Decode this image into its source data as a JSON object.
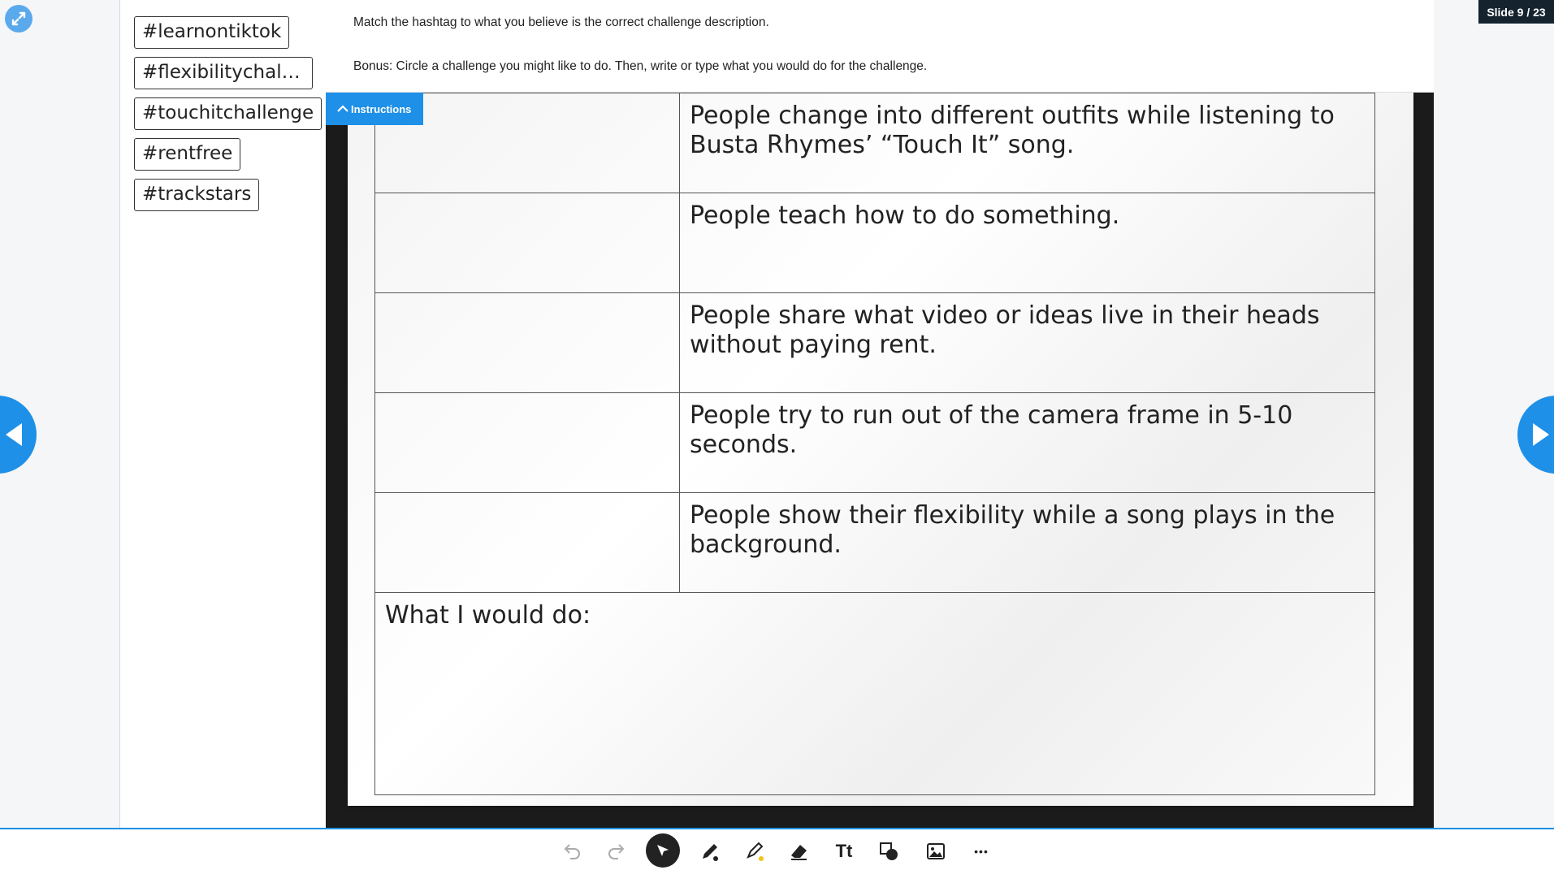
{
  "slide_counter": "Slide 9 / 23",
  "tags": [
    "#learnontiktok",
    "#flexibilitychalle...",
    "#touchitchallenge",
    "#rentfree",
    "#trackstars"
  ],
  "instructions": {
    "line1": "Match the hashtag to what you believe is the correct challenge description.",
    "line2": "Bonus: Circle a challenge you might like to do. Then, write or type what you would do for the challenge.",
    "toggle_label": "Instructions"
  },
  "table": {
    "descriptions": [
      "People change into different outfits while listening to Busta Rhymes’ “Touch It” song.",
      "People teach how to do something.",
      "People share what video or ideas live in their heads without paying rent.",
      "People try to run out of the camera frame in  5-10 seconds.",
      "People show their flexibility while a song plays in the background."
    ],
    "would_label": "What I would do:"
  },
  "colors": {
    "accent": "#1e90e8",
    "counter_bg": "#15232f",
    "slide_bg": "#1b1b1b"
  },
  "toolbar": {
    "tools": [
      "undo-icon",
      "redo-icon",
      "select-icon",
      "pen-icon",
      "highlighter-icon",
      "eraser-icon",
      "text-tool",
      "shapes-icon",
      "image-icon",
      "more-icon"
    ],
    "text_tool_label": "Tt",
    "more_label": "•••"
  }
}
